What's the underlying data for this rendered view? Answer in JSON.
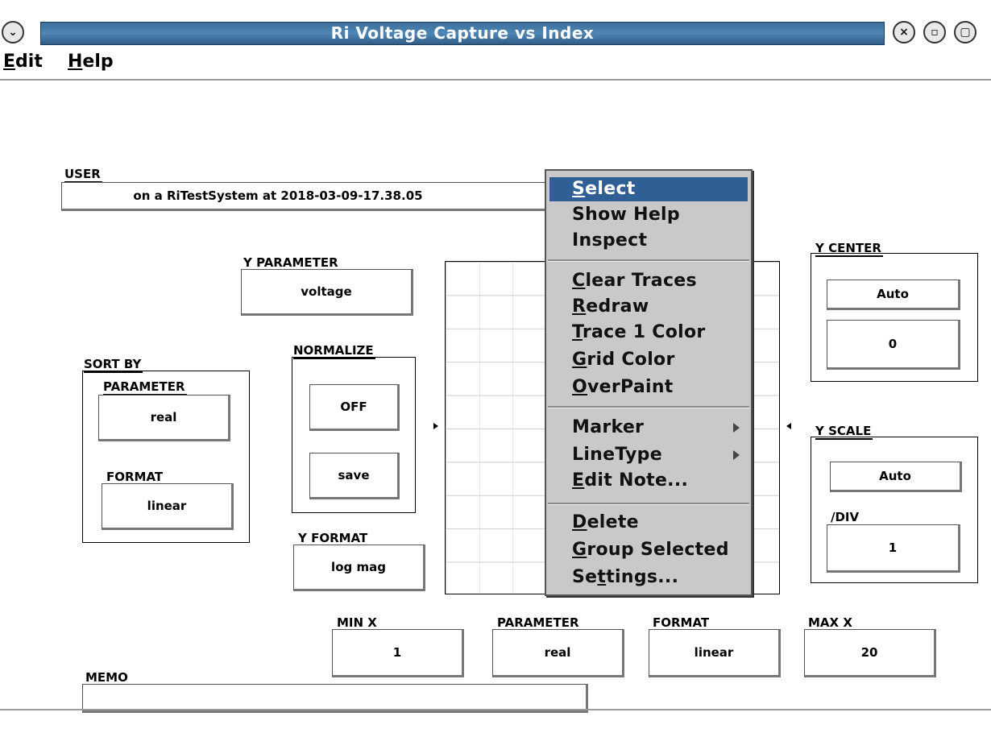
{
  "window": {
    "title": "Ri Voltage Capture vs Index"
  },
  "menubar": {
    "edit": "dit",
    "edit_key": "E",
    "help": "elp",
    "help_key": "H"
  },
  "user": {
    "label": "USER",
    "value": "on a RiTestSystem at 2018-03-09-17.38.05"
  },
  "y_parameter": {
    "label": "Y PARAMETER",
    "value": "voltage"
  },
  "normalize": {
    "label": "NORMALIZE",
    "state": "OFF",
    "save": "save"
  },
  "sort_by": {
    "label": "SORT BY",
    "param_label": "PARAMETER",
    "param_value": "real",
    "format_label": "FORMAT",
    "format_value": "linear"
  },
  "y_format": {
    "label": "Y FORMAT",
    "value": "log mag"
  },
  "y_center": {
    "label": "Y CENTER",
    "auto": "Auto",
    "value": "0"
  },
  "y_scale": {
    "label": "Y SCALE",
    "auto": "Auto",
    "div_label": "/DIV",
    "div_value": "1"
  },
  "x_axis": {
    "min_label": "MIN X",
    "min_value": "1",
    "param_label": "PARAMETER",
    "param_value": "real",
    "format_label": "FORMAT",
    "format_value": "linear",
    "max_label": "MAX X",
    "max_value": "20"
  },
  "memo": {
    "label": "MEMO",
    "value": ""
  },
  "context_menu": {
    "select": {
      "key": "S",
      "rest": "elect"
    },
    "show_help": "Show Help",
    "inspect": "Inspect",
    "clear_traces": {
      "key": "C",
      "rest": "lear Traces"
    },
    "redraw": {
      "key": "R",
      "rest": "edraw"
    },
    "trace_color": {
      "key": "T",
      "rest": "race 1 Color"
    },
    "grid_color": {
      "key": "G",
      "rest": "rid Color"
    },
    "overpaint": {
      "key": "O",
      "rest": "verPaint"
    },
    "marker": "Marker",
    "linetype": "LineType",
    "edit_note": {
      "key": "E",
      "rest": "dit Note..."
    },
    "delete": {
      "key": "D",
      "rest": "elete"
    },
    "group_selected": {
      "key": "G",
      "rest": "roup Selected"
    },
    "settings": {
      "pre": "Se",
      "key": "t",
      "rest": "tings..."
    }
  }
}
